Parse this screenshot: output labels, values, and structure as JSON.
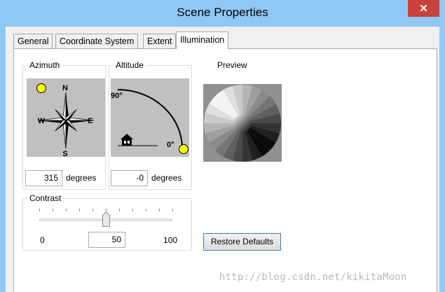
{
  "window": {
    "title": "Scene Properties",
    "close_symbol": "✕"
  },
  "tabs": [
    {
      "label": "General",
      "active": false
    },
    {
      "label": "Coordinate System",
      "active": false
    },
    {
      "label": "Extent",
      "active": false
    },
    {
      "label": "Illumination",
      "active": true
    }
  ],
  "azimuth": {
    "label": "Azimuth",
    "value": "315",
    "unit": "degrees",
    "compass": {
      "n": "N",
      "s": "S",
      "e": "E",
      "w": "W"
    }
  },
  "altitude": {
    "label": "Altitude",
    "value": "-0",
    "unit": "degrees",
    "tick_90": "90°",
    "tick_0": "0°"
  },
  "preview": {
    "label": "Preview"
  },
  "contrast": {
    "label": "Contrast",
    "min_label": "0",
    "max_label": "100",
    "value": "50",
    "level_fraction": 0.5
  },
  "buttons": {
    "restore_defaults": "Restore Defaults"
  },
  "watermark": "http://blog.csdn.net/kikitaMoon",
  "colors": {
    "sun": "#ffff00",
    "title_bar": "#8fc8f4",
    "close": "#c7433b"
  }
}
